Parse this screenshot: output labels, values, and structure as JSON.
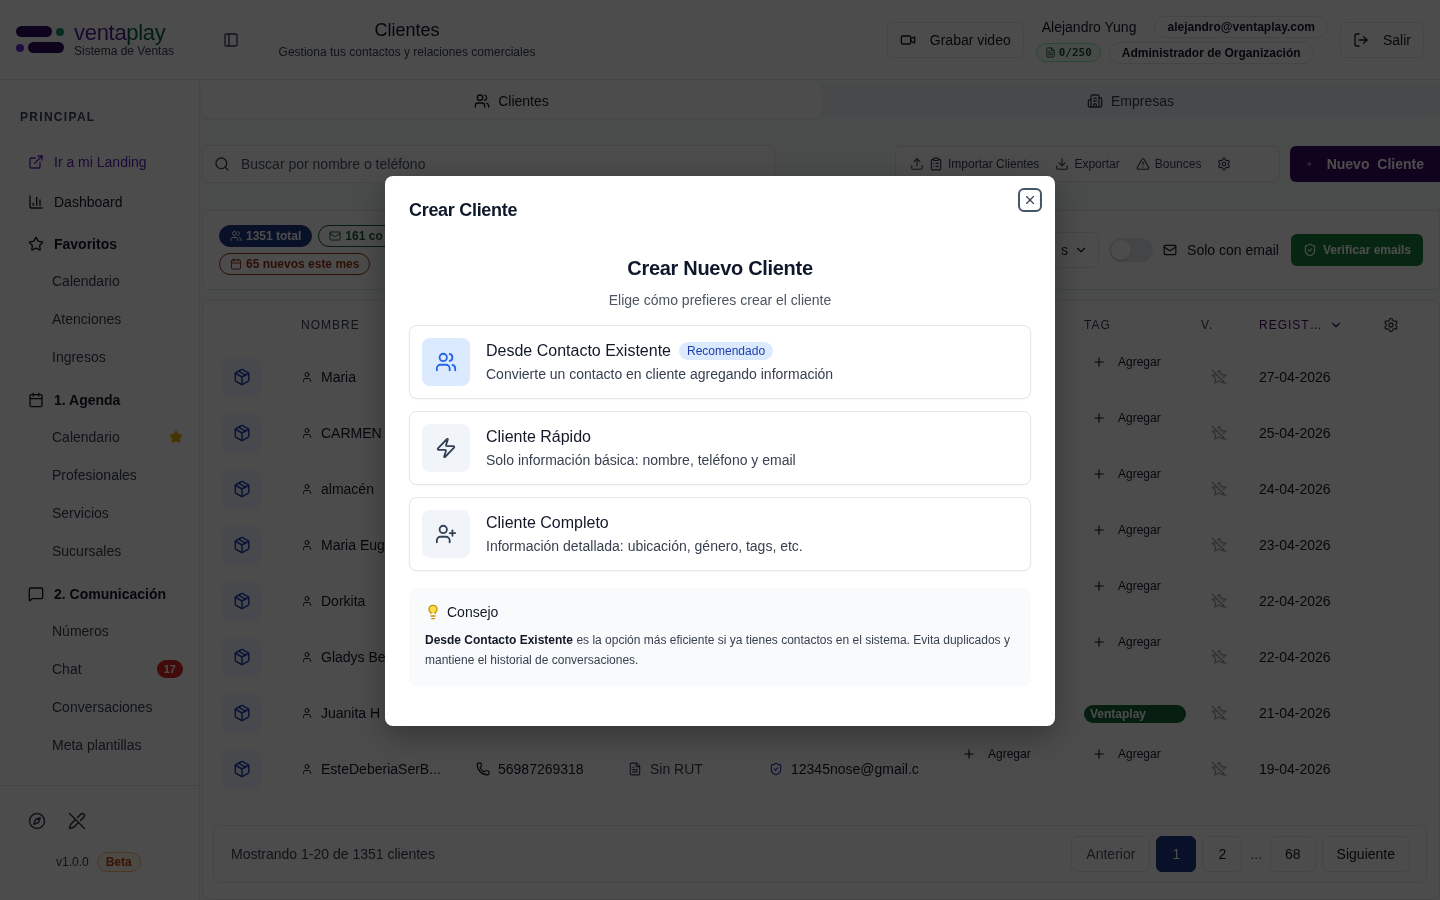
{
  "brand": {
    "first": "venta",
    "second": "play",
    "tagline": "Sistema de Ventas"
  },
  "header": {
    "title": "Clientes",
    "subtitle": "Gestiona tus contactos y relaciones comerciales",
    "record_button": "Grabar video",
    "user": {
      "name": "Alejandro Yung",
      "email": "alejandro@ventaplay.com",
      "quota": "0/250",
      "role": "Administrador de Organización"
    },
    "logout": "Salir"
  },
  "sidebar": {
    "section": "PRINCIPAL",
    "items": [
      {
        "kind": "link",
        "label": "Ir a mi Landing"
      },
      {
        "kind": "item",
        "label": "Dashboard"
      },
      {
        "kind": "group",
        "label": "Favoritos",
        "children": [
          {
            "label": "Calendario",
            "favorite": false
          },
          {
            "label": "Atenciones",
            "favorite": false
          },
          {
            "label": "Ingresos",
            "favorite": false
          }
        ]
      },
      {
        "kind": "group",
        "label": "1. Agenda",
        "children": [
          {
            "label": "Calendario",
            "favorite": true
          },
          {
            "label": "Profesionales",
            "favorite": false
          },
          {
            "label": "Servicios",
            "favorite": false
          },
          {
            "label": "Sucursales",
            "favorite": false
          }
        ]
      },
      {
        "kind": "group",
        "label": "2. Comunicación",
        "children": [
          {
            "label": "Números",
            "favorite": false
          },
          {
            "label": "Chat",
            "favorite": false,
            "badge": "17"
          },
          {
            "label": "Conversaciones",
            "favorite": false
          },
          {
            "label": "Meta plantillas",
            "favorite": false
          }
        ]
      }
    ],
    "version": "v1.0.0",
    "version_badge": "Beta"
  },
  "tabs": [
    {
      "label": "Clientes",
      "selected": true
    },
    {
      "label": "Empresas",
      "selected": false
    }
  ],
  "toolbar": {
    "search_placeholder": "Buscar por nombre o teléfono",
    "actions": [
      {
        "kind": "import",
        "label": "Importar Clientes"
      },
      {
        "kind": "export",
        "label": "Exportar"
      },
      {
        "kind": "bounces",
        "label": "Bounces"
      },
      {
        "kind": "settings"
      }
    ],
    "primary": "Nuevo Cliente"
  },
  "stats": {
    "pills": [
      {
        "kind": "total",
        "label": "1351 total"
      },
      {
        "kind": "contacts",
        "label": "161 co"
      },
      {
        "kind": "new",
        "label": "65 nuevos este mes"
      }
    ],
    "filter_value": "s",
    "email_toggle": {
      "label": "Solo con email",
      "on": false
    },
    "verify_button": "Verificar emails"
  },
  "table": {
    "columns": [
      {
        "label": "NOMBRE",
        "sorted": false
      },
      {
        "label": "TAG",
        "sorted": false
      },
      {
        "label": "V.",
        "sorted": false
      },
      {
        "label": "REGIST…",
        "sorted": true
      }
    ],
    "rows": [
      {
        "name": "Maria",
        "tag": {
          "kind": "add",
          "label": "Agregar"
        },
        "date": "27-04-2026"
      },
      {
        "name": "CARMEN",
        "tag": {
          "kind": "add",
          "label": "Agregar"
        },
        "date": "25-04-2026"
      },
      {
        "name": "almacén",
        "tag": {
          "kind": "add",
          "label": "Agregar"
        },
        "date": "24-04-2026"
      },
      {
        "name": "Maria Eug",
        "tag": {
          "kind": "add",
          "label": "Agregar"
        },
        "date": "23-04-2026"
      },
      {
        "name": "Dorkita",
        "tag": {
          "kind": "add",
          "label": "Agregar"
        },
        "date": "22-04-2026"
      },
      {
        "name": "Gladys Be",
        "tag": {
          "kind": "add",
          "label": "Agregar"
        },
        "date": "22-04-2026"
      },
      {
        "name": "Juanita H",
        "tag": {
          "kind": "tag",
          "label": "Ventaplay"
        },
        "date": "21-04-2026"
      },
      {
        "name": "EsteDeberiaSerB...",
        "phone": "56987269318",
        "rut": "Sin RUT",
        "email": "12345nose@gmail.c",
        "column_6": {
          "kind": "add",
          "label": "Agregar"
        },
        "tag": {
          "kind": "add",
          "label": "Agregar"
        },
        "date": "19-04-2026"
      }
    ]
  },
  "pagination": {
    "summary": "Mostrando 1-20 de 1351 clientes",
    "previous": {
      "label": "Anterior",
      "disabled": true
    },
    "pages": [
      {
        "kind": "page",
        "label": "1",
        "selected": true
      },
      {
        "kind": "page",
        "label": "2",
        "selected": false
      },
      {
        "kind": "gap",
        "label": "..."
      },
      {
        "kind": "page",
        "label": "68",
        "selected": false
      }
    ],
    "next": {
      "label": "Siguiente",
      "disabled": false
    }
  },
  "modal": {
    "title": "Crear Cliente",
    "heading": "Crear Nuevo Cliente",
    "subtitle": "Elige cómo prefieres crear el cliente",
    "options": [
      {
        "kind": "existing",
        "title": "Desde Contacto Existente",
        "badge": "Recomendado",
        "description": "Convierte un contacto en cliente agregando información"
      },
      {
        "kind": "quick",
        "title": "Cliente Rápido",
        "description": "Solo información básica: nombre, teléfono y email"
      },
      {
        "kind": "full",
        "title": "Cliente Completo",
        "description": "Información detallada: ubicación, género, tags, etc."
      }
    ],
    "tip": {
      "title": "Consejo",
      "text": "**Desde Contacto Existente** es la opción más eficiente si ya tienes contactos en el sistema. Evita duplicados y mantiene el historial de conversaciones."
    }
  }
}
